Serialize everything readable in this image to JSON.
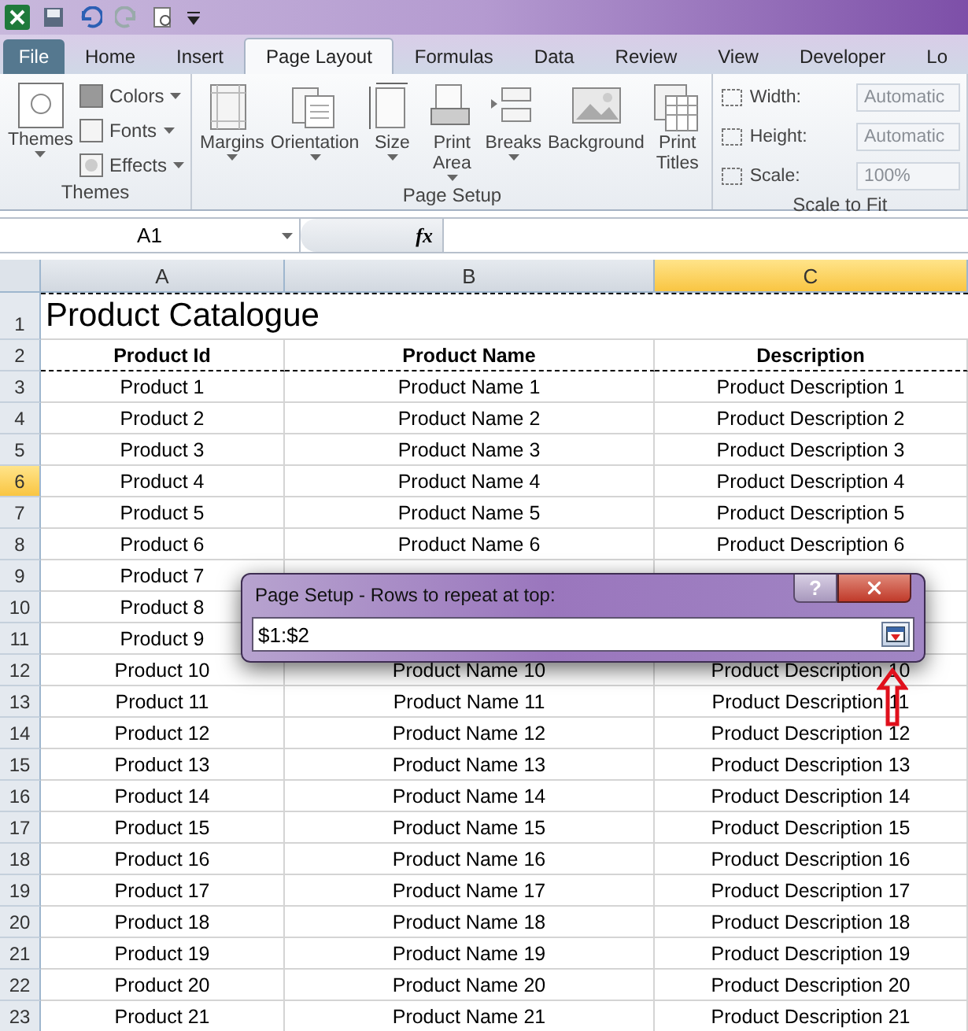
{
  "ribbon": {
    "tabs": [
      {
        "label": "File",
        "selected": false,
        "kind": "file"
      },
      {
        "label": "Home",
        "selected": false,
        "kind": "tab"
      },
      {
        "label": "Insert",
        "selected": false,
        "kind": "tab"
      },
      {
        "label": "Page Layout",
        "selected": true,
        "kind": "tab"
      },
      {
        "label": "Formulas",
        "selected": false,
        "kind": "tab"
      },
      {
        "label": "Data",
        "selected": false,
        "kind": "tab"
      },
      {
        "label": "Review",
        "selected": false,
        "kind": "tab"
      },
      {
        "label": "View",
        "selected": false,
        "kind": "tab"
      },
      {
        "label": "Developer",
        "selected": false,
        "kind": "tab"
      },
      {
        "label": "Lo",
        "selected": false,
        "kind": "tab"
      }
    ],
    "groups": [
      {
        "name": "Themes",
        "items": [
          {
            "kind": "large",
            "label": "Themes",
            "dropdown": true
          },
          {
            "kind": "small",
            "label": "Colors",
            "dropdown": true
          },
          {
            "kind": "small",
            "label": "Fonts",
            "dropdown": true
          },
          {
            "kind": "small",
            "label": "Effects",
            "dropdown": true
          }
        ]
      },
      {
        "name": "Page Setup",
        "items": [
          {
            "kind": "large",
            "label": "Margins",
            "dropdown": true
          },
          {
            "kind": "large",
            "label": "Orientation",
            "dropdown": true
          },
          {
            "kind": "large",
            "label": "Size",
            "dropdown": true
          },
          {
            "kind": "large",
            "label": "Print Area",
            "dropdown": true
          },
          {
            "kind": "large",
            "label": "Breaks",
            "dropdown": true
          },
          {
            "kind": "large",
            "label": "Background",
            "dropdown": false
          },
          {
            "kind": "large",
            "label": "Print Titles",
            "dropdown": false
          }
        ]
      },
      {
        "name": "Scale to Fit",
        "items": [
          {
            "kind": "field",
            "label": "Width:",
            "value": "Automatic",
            "disabled": true
          },
          {
            "kind": "field",
            "label": "Height:",
            "value": "Automatic",
            "disabled": true
          },
          {
            "kind": "field",
            "label": "Scale:",
            "value": "100%",
            "disabled": true
          }
        ]
      }
    ]
  },
  "formula_bar": {
    "name_box": "A1",
    "fx": "fx"
  },
  "sheet": {
    "columns": [
      {
        "label": "A",
        "selected": false
      },
      {
        "label": "B",
        "selected": false
      },
      {
        "label": "C",
        "selected": true
      }
    ],
    "rows": [
      {
        "number": "1",
        "selected": false,
        "kind": "title",
        "cells": [
          "Product Catalogue"
        ]
      },
      {
        "number": "2",
        "selected": false,
        "kind": "header",
        "cells": [
          "Product Id",
          "Product Name",
          "Description"
        ]
      },
      {
        "number": "3",
        "selected": false,
        "kind": "data",
        "cells": [
          "Product 1",
          "Product Name 1",
          "Product Description 1"
        ]
      },
      {
        "number": "4",
        "selected": false,
        "kind": "data",
        "cells": [
          "Product 2",
          "Product Name 2",
          "Product Description 2"
        ]
      },
      {
        "number": "5",
        "selected": false,
        "kind": "data",
        "cells": [
          "Product 3",
          "Product Name 3",
          "Product Description 3"
        ]
      },
      {
        "number": "6",
        "selected": true,
        "kind": "data",
        "cells": [
          "Product 4",
          "Product Name 4",
          "Product Description 4"
        ]
      },
      {
        "number": "7",
        "selected": false,
        "kind": "data",
        "cells": [
          "Product 5",
          "Product Name 5",
          "Product Description 5"
        ]
      },
      {
        "number": "8",
        "selected": false,
        "kind": "data",
        "cells": [
          "Product 6",
          "Product Name 6",
          "Product Description 6"
        ]
      },
      {
        "number": "9",
        "selected": false,
        "kind": "data",
        "cells": [
          "Product 7"
        ]
      },
      {
        "number": "10",
        "selected": false,
        "kind": "data",
        "cells": [
          "Product 8"
        ]
      },
      {
        "number": "11",
        "selected": false,
        "kind": "data",
        "cells": [
          "Product 9"
        ]
      },
      {
        "number": "12",
        "selected": false,
        "kind": "data",
        "cells": [
          "Product 10",
          "Product Name 10",
          "Product Description 10"
        ]
      },
      {
        "number": "13",
        "selected": false,
        "kind": "data",
        "cells": [
          "Product 11",
          "Product Name 11",
          "Product Description 11"
        ]
      },
      {
        "number": "14",
        "selected": false,
        "kind": "data",
        "cells": [
          "Product 12",
          "Product Name 12",
          "Product Description 12"
        ]
      },
      {
        "number": "15",
        "selected": false,
        "kind": "data",
        "cells": [
          "Product 13",
          "Product Name 13",
          "Product Description 13"
        ]
      },
      {
        "number": "16",
        "selected": false,
        "kind": "data",
        "cells": [
          "Product 14",
          "Product Name 14",
          "Product Description 14"
        ]
      },
      {
        "number": "17",
        "selected": false,
        "kind": "data",
        "cells": [
          "Product 15",
          "Product Name 15",
          "Product Description 15"
        ]
      },
      {
        "number": "18",
        "selected": false,
        "kind": "data",
        "cells": [
          "Product 16",
          "Product Name 16",
          "Product Description 16"
        ]
      },
      {
        "number": "19",
        "selected": false,
        "kind": "data",
        "cells": [
          "Product 17",
          "Product Name 17",
          "Product Description 17"
        ]
      },
      {
        "number": "20",
        "selected": false,
        "kind": "data",
        "cells": [
          "Product 18",
          "Product Name 18",
          "Product Description 18"
        ]
      },
      {
        "number": "21",
        "selected": false,
        "kind": "data",
        "cells": [
          "Product 19",
          "Product Name 19",
          "Product Description 19"
        ]
      },
      {
        "number": "22",
        "selected": false,
        "kind": "data",
        "cells": [
          "Product 20",
          "Product Name 20",
          "Product Description 20"
        ]
      },
      {
        "number": "23",
        "selected": false,
        "kind": "data",
        "cells": [
          "Product 21",
          "Product Name 21",
          "Product Description 21"
        ]
      }
    ]
  },
  "dialog": {
    "title": "Page Setup - Rows to repeat at top:",
    "help_button": "?",
    "value": "$1:$2"
  }
}
